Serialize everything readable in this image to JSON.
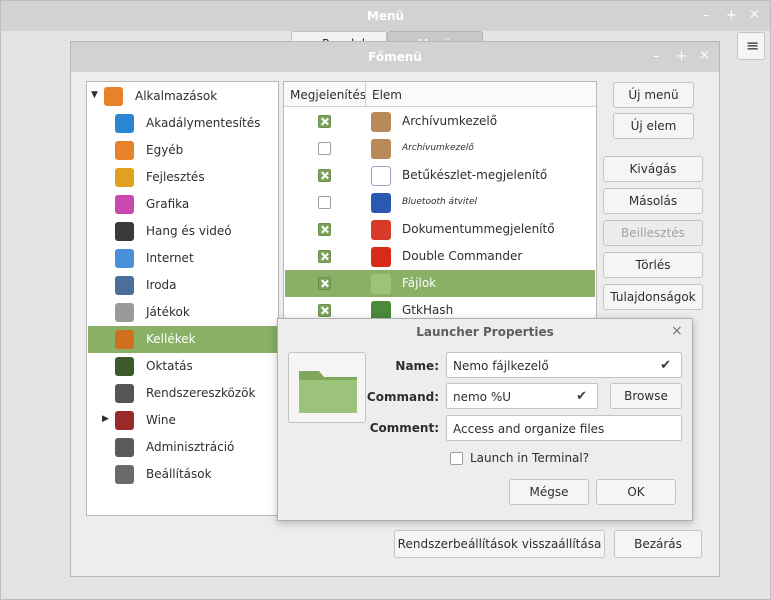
{
  "outer_window": {
    "title": "Menü",
    "tabs": [
      "Panelek",
      "Menü"
    ],
    "controls": {
      "minimize": "–",
      "maximize": "+",
      "close": "×"
    },
    "hamburger": "≡"
  },
  "main_window": {
    "title": "Főmenü",
    "controls": {
      "minimize": "–",
      "maximize": "+",
      "close": "×"
    }
  },
  "categories": [
    {
      "label": "Alkalmazások",
      "expander": "▼",
      "icon": "applications-icon",
      "color": "#e8822a"
    },
    {
      "label": "Akadálymentesítés",
      "icon": "accessibility-icon",
      "color": "#2a86d0"
    },
    {
      "label": "Egyéb",
      "icon": "other-icon",
      "color": "#e8822a"
    },
    {
      "label": "Fejlesztés",
      "icon": "development-icon",
      "color": "#e0a020"
    },
    {
      "label": "Grafika",
      "icon": "graphics-icon",
      "color": "#c84ab0"
    },
    {
      "label": "Hang és videó",
      "icon": "multimedia-icon",
      "color": "#3a3a3a"
    },
    {
      "label": "Internet",
      "icon": "internet-icon",
      "color": "#4a90d9"
    },
    {
      "label": "Iroda",
      "icon": "office-icon",
      "color": "#4a6f9a"
    },
    {
      "label": "Játékok",
      "icon": "games-icon",
      "color": "#9a9a9a"
    },
    {
      "label": "Kellékek",
      "icon": "accessories-icon",
      "color": "#d0701e",
      "selected": true
    },
    {
      "label": "Oktatás",
      "icon": "education-icon",
      "color": "#3d5a2a"
    },
    {
      "label": "Rendszereszközök",
      "icon": "system-tools-icon",
      "color": "#555555"
    },
    {
      "label": "Wine",
      "expander": "▶",
      "icon": "wine-icon",
      "color": "#9a2a2a"
    },
    {
      "label": "Adminisztráció",
      "icon": "administration-icon",
      "color": "#5a5a5a"
    },
    {
      "label": "Beállítások",
      "icon": "settings-icon",
      "color": "#6a6a6a"
    }
  ],
  "items_table": {
    "headers": {
      "show": "Megjelenítés",
      "item": "Elem"
    },
    "rows": [
      {
        "label": "Archívumkezelő",
        "checked": true,
        "icon": "archive-manager-icon",
        "color": "#b88a5a"
      },
      {
        "label": "Archívumkezelő",
        "checked": false,
        "small": true,
        "icon": "archive-manager-icon",
        "color": "#b88a5a"
      },
      {
        "label": "Betűkészlet-megjelenítő",
        "checked": true,
        "icon": "font-viewer-icon",
        "color": "#ffffff"
      },
      {
        "label": "Bluetooth átvitel",
        "checked": false,
        "small": true,
        "icon": "bluetooth-icon",
        "color": "#2a5ab0"
      },
      {
        "label": "Dokumentummegjelenítő",
        "checked": true,
        "icon": "document-viewer-icon",
        "color": "#d83a2a"
      },
      {
        "label": "Double Commander",
        "checked": true,
        "icon": "double-commander-icon",
        "color": "#d82a1a"
      },
      {
        "label": "Fájlok",
        "checked": true,
        "selected": true,
        "icon": "folder-icon",
        "color": "#9bc47a"
      },
      {
        "label": "GtkHash",
        "checked": true,
        "icon": "gtkhash-icon",
        "color": "#4a8a3a"
      }
    ]
  },
  "side_buttons": {
    "new_menu": "Új menü",
    "new_item": "Új elem",
    "cut": "Kivágás",
    "copy": "Másolás",
    "paste": "Beillesztés",
    "delete": "Törlés",
    "properties": "Tulajdonságok"
  },
  "bottom_buttons": {
    "restore": "Rendszerbeállítások visszaállítása",
    "close": "Bezárás"
  },
  "launcher_dialog": {
    "title": "Launcher Properties",
    "close": "×",
    "name_label": "Name:",
    "name_value": "Nemo fájlkezelő",
    "command_label": "Command:",
    "command_value": "nemo %U",
    "browse": "Browse",
    "comment_label": "Comment:",
    "comment_value": "Access and organize files",
    "terminal_label": "Launch in Terminal?",
    "terminal_checked": false,
    "check": "✔",
    "cancel": "Mégse",
    "ok": "OK"
  },
  "colors": {
    "selection": "#8ab066",
    "titlebar": "#d2d2d2",
    "folder": "#9bc47a"
  }
}
